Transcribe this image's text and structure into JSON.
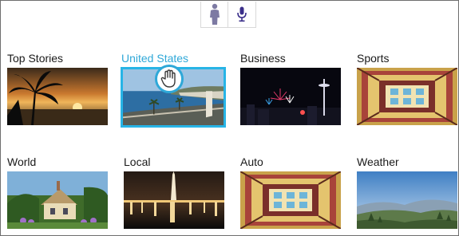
{
  "toolbar": {
    "items": [
      {
        "icon": "person-silhouette-icon"
      },
      {
        "icon": "microphone-icon"
      }
    ],
    "accent": "#4a3f8c"
  },
  "accent_color": "#2fa8d8",
  "tiles": [
    {
      "label": "Top Stories",
      "image": "palm-tree-sunset",
      "selected": false
    },
    {
      "label": "United States",
      "image": "coastal-town-bay",
      "selected": true
    },
    {
      "label": "Business",
      "image": "city-tower-fireworks",
      "selected": false
    },
    {
      "label": "Sports",
      "image": "ornate-ceiling",
      "selected": false
    },
    {
      "label": "World",
      "image": "cottage-garden",
      "selected": false
    },
    {
      "label": "Local",
      "image": "monument-night-reflection",
      "selected": false
    },
    {
      "label": "Auto",
      "image": "ornate-ceiling",
      "selected": false
    },
    {
      "label": "Weather",
      "image": "mountain-landscape",
      "selected": false
    }
  ],
  "cursor": {
    "icon": "hand-pointer-icon"
  }
}
